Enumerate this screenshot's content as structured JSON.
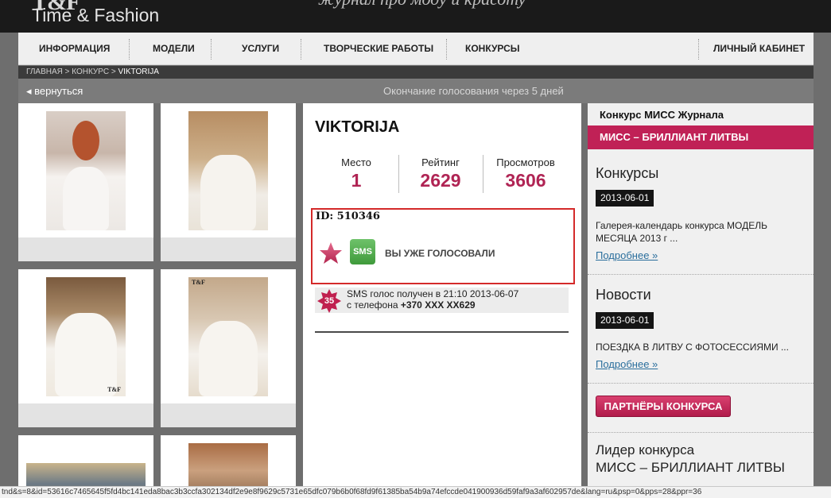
{
  "header": {
    "logo_mark": "T&F",
    "logo_text": "Time & Fashion",
    "slogan": "журнал про моду и красоту"
  },
  "nav": {
    "items": [
      "ИНФОРМАЦИЯ",
      "МОДЕЛИ",
      "УСЛУГИ",
      "ТВОРЧЕСКИЕ РАБОТЫ",
      "КОНКУРСЫ"
    ],
    "account": "ЛИЧНЫЙ КАБИНЕТ"
  },
  "breadcrumb": {
    "home": "ГЛАВНАЯ",
    "sep": ">",
    "contest": "КОНКУРС",
    "current": "VIKTORIJA"
  },
  "subbar": {
    "back": "◂ вернуться",
    "voting_end": "Окончание голосования через 5 дней"
  },
  "gallery": {
    "watermark": "T&F"
  },
  "profile": {
    "name": "VIKTORIJA",
    "stats": [
      {
        "label": "Место",
        "value": "1"
      },
      {
        "label": "Рейтинг",
        "value": "2629"
      },
      {
        "label": "Просмотров",
        "value": "3606"
      }
    ],
    "vote": {
      "id_text": "ID: 510346",
      "sms_badge": "SMS",
      "voted_text": "ВЫ УЖЕ ГОЛОСОВАЛИ"
    },
    "sms_log": {
      "count": "35",
      "line1": "SMS голос получен в 21:10  2013-06-07",
      "line2_prefix": "с телефона ",
      "phone": "+370 XXX XX629"
    }
  },
  "sidebar": {
    "title": "Конкурс МИСС Журнала",
    "banner": "МИСС – БРИЛЛИАНТ ЛИТВЫ",
    "contests": {
      "heading": "Конкурсы",
      "date": "2013-06-01",
      "text": "Галерея-календарь конкурса МОДЕЛЬ МЕСЯЦА 2013 г ...",
      "more": "Подробнее »"
    },
    "news": {
      "heading": "Новости",
      "date": "2013-06-01",
      "text": "ПОЕЗДКА В ЛИТВУ С ФОТОСЕССИЯМИ ...",
      "more": "Подробнее »"
    },
    "partners_button": "ПАРТНЁРЫ КОНКУРСА",
    "leader_line1": "Лидер конкурса",
    "leader_line2": "МИСС – БРИЛЛИАНТ ЛИТВЫ"
  },
  "statusbar": {
    "url": "tnd&s=8&id=53616c7465645f5fd4bc141eda8bac3b3ccfa302134df2e9e8f9629c5731e65dfc079b6b0f68fd9f61385ba54b9a74efccde041900936d59faf9a3af602957de&lang=ru&psp=0&pps=28&ppr=36"
  },
  "colors": {
    "accent": "#c02156",
    "stat_value": "#b02454",
    "vote_box_border": "#d42a2a",
    "sms_green": "#4caf50",
    "link": "#2a6e9c"
  }
}
